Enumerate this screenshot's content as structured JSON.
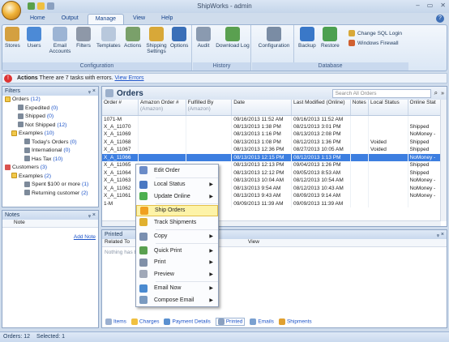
{
  "app": {
    "title": "ShipWorks - admin"
  },
  "tabs": [
    "Home",
    "Output",
    "Manage",
    "View",
    "Help"
  ],
  "ribbon": {
    "groups": {
      "configuration": "Configuration",
      "history": "History",
      "database": "Database"
    },
    "buttons": {
      "stores": "Stores",
      "users": "Users",
      "email_accounts": "Email Accounts",
      "filters": "Filters",
      "templates": "Templates",
      "actions": "Actions",
      "shipping_settings": "Shipping Settings",
      "options": "Options",
      "audit": "Audit",
      "download_log": "Download Log",
      "configuration": "Configuration",
      "backup": "Backup",
      "restore": "Restore",
      "change_sql_login": "Change SQL Login",
      "windows_firewall": "Windows Firewall"
    }
  },
  "alert": {
    "label": "Actions",
    "text": "There are 7 tasks with errors.",
    "link": "View Errors"
  },
  "filters": {
    "title": "Filters",
    "pin": "ᵩ",
    "close": "×",
    "items": [
      {
        "label": "Orders",
        "count": "(12)",
        "indent": 0,
        "icon": "y"
      },
      {
        "label": "Expedited",
        "count": "(0)",
        "indent": 2,
        "icon": "f"
      },
      {
        "label": "Shipped",
        "count": "(0)",
        "indent": 2,
        "icon": "f"
      },
      {
        "label": "Not Shipped",
        "count": "(12)",
        "indent": 2,
        "icon": "f"
      },
      {
        "label": "Examples",
        "count": "(10)",
        "indent": 1,
        "icon": "y"
      },
      {
        "label": "Today's Orders",
        "count": "(0)",
        "indent": 3,
        "icon": "f"
      },
      {
        "label": "International",
        "count": "(0)",
        "indent": 3,
        "icon": "f"
      },
      {
        "label": "Has Tax",
        "count": "(10)",
        "indent": 3,
        "icon": "f"
      },
      {
        "label": "Customers",
        "count": "(3)",
        "indent": 0,
        "icon": "r"
      },
      {
        "label": "Examples",
        "count": "(2)",
        "indent": 1,
        "icon": "y"
      },
      {
        "label": "Spent $100 or more",
        "count": "(1)",
        "indent": 3,
        "icon": "f"
      },
      {
        "label": "Returning customer",
        "count": "(2)",
        "indent": 3,
        "icon": "f"
      }
    ]
  },
  "notes": {
    "title": "Notes",
    "column": "Note",
    "add_link": "Add Note"
  },
  "orders": {
    "title": "Orders",
    "search_placeholder": "Search All Orders",
    "columns": [
      {
        "label": "Order #",
        "sub": ""
      },
      {
        "label": "Amazon Order #",
        "sub": "(Amazon)"
      },
      {
        "label": "Fulfilled By",
        "sub": "(Amazon)"
      },
      {
        "label": "Date",
        "sub": ""
      },
      {
        "label": "Last Modified (Online)",
        "sub": ""
      },
      {
        "label": "Notes",
        "sub": ""
      },
      {
        "label": "Local Status",
        "sub": ""
      },
      {
        "label": "Online Stat",
        "sub": ""
      }
    ],
    "rows": [
      [
        "1071-M",
        "",
        "",
        "09/16/2013 11:52 AM",
        "09/16/2013 11:52 AM",
        "",
        "",
        ""
      ],
      [
        "X_A_11070",
        "",
        "",
        "08/13/2013 1:38 PM",
        "08/21/2013 3:01 PM",
        "",
        "",
        "Shipped"
      ],
      [
        "X_A_11069",
        "",
        "",
        "08/13/2013 1:16 PM",
        "08/13/2013 2:08 PM",
        "",
        "",
        "NoMoney -"
      ],
      [
        "X_A_11068",
        "",
        "",
        "08/13/2013 1:08 PM",
        "08/12/2013 1:36 PM",
        "",
        "Voided",
        "Shipped"
      ],
      [
        "X_A_11067",
        "",
        "",
        "08/13/2013 12:36 PM",
        "08/27/2013 10:05 AM",
        "",
        "Voided",
        "Shipped"
      ],
      [
        "X_A_11066",
        "",
        "",
        "08/13/2013 12:15 PM",
        "08/12/2013 1:13 PM",
        "",
        "",
        "NoMoney -"
      ],
      [
        "X_A_11065",
        "",
        "",
        "08/13/2013 12:13 PM",
        "09/04/2013 1:26 PM",
        "",
        "",
        "Shipped"
      ],
      [
        "X_A_11064",
        "",
        "",
        "08/13/2013 12:12 PM",
        "09/05/2013 8:53 AM",
        "",
        "",
        "Shipped"
      ],
      [
        "X_A_11063",
        "",
        "",
        "08/13/2013 10:04 AM",
        "08/12/2013 10:54 AM",
        "",
        "",
        "NoMoney -"
      ],
      [
        "X_A_11062",
        "",
        "",
        "08/13/2013 9:54 AM",
        "08/12/2013 10:43 AM",
        "",
        "",
        "NoMoney -"
      ],
      [
        "X_A_11061",
        "",
        "",
        "08/13/2013 9:43 AM",
        "08/09/2013 9:14 AM",
        "",
        "",
        "NoMoney -"
      ],
      [
        "1-M",
        "",
        "",
        "09/09/2013 11:39 AM",
        "09/09/2013 11:39 AM",
        "",
        "",
        ""
      ]
    ]
  },
  "printed": {
    "title": "Printed",
    "col1": "Related To",
    "col2": "View",
    "empty": "Nothing has b"
  },
  "bottom_tabs": [
    "Items",
    "Charges",
    "Payment Details",
    "Printed",
    "Emails",
    "Shipments"
  ],
  "context_menu": [
    {
      "label": "Edit Order",
      "arrow": false,
      "color": "#6b8cc8"
    },
    {
      "sep": true
    },
    {
      "label": "Local Status",
      "arrow": true,
      "color": "#4a78c2"
    },
    {
      "label": "Update Online",
      "arrow": true,
      "color": "#4caf50"
    },
    {
      "sep": true
    },
    {
      "label": "Ship Orders",
      "arrow": false,
      "color": "#f0a020",
      "hl": true
    },
    {
      "label": "Track Shipments",
      "arrow": false,
      "color": "#e0b030"
    },
    {
      "sep": true
    },
    {
      "label": "Copy",
      "arrow": true,
      "color": "#7a8fb0"
    },
    {
      "sep": true
    },
    {
      "label": "Quick Print",
      "arrow": true,
      "color": "#5aa050"
    },
    {
      "label": "Print",
      "arrow": true,
      "color": "#8090a8"
    },
    {
      "label": "Preview",
      "arrow": true,
      "color": "#a0a8b8"
    },
    {
      "sep": true
    },
    {
      "label": "Email Now",
      "arrow": true,
      "color": "#4a8ad0"
    },
    {
      "label": "Compose Email",
      "arrow": true,
      "color": "#7a9ac0"
    }
  ],
  "status": {
    "orders": "Orders: 12",
    "selected": "Selected: 1"
  }
}
